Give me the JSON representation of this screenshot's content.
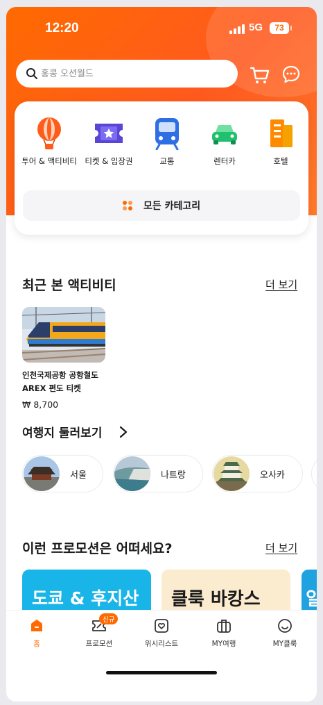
{
  "status_bar": {
    "time": "12:20",
    "network": "5G",
    "battery": "73"
  },
  "search": {
    "placeholder": "홍콩 오션월드"
  },
  "categories": [
    {
      "label": "투어 & 액티비티",
      "icon": "balloon-icon"
    },
    {
      "label": "티켓 & 입장권",
      "icon": "ticket-icon"
    },
    {
      "label": "교통",
      "icon": "train-icon"
    },
    {
      "label": "렌터카",
      "icon": "car-icon"
    },
    {
      "label": "호텔",
      "icon": "hotel-icon"
    }
  ],
  "all_categories_label": "모든 카테고리",
  "recent": {
    "title": "최근 본 액티비티",
    "more_label": "더 보기",
    "items": [
      {
        "title": "인천국제공항 공항철도 AREX 편도 티켓",
        "price": "₩ 8,700"
      }
    ]
  },
  "destinations": {
    "title": "여행지 둘러보기",
    "items": [
      {
        "label": "서울"
      },
      {
        "label": "나트랑"
      },
      {
        "label": "오사카"
      }
    ]
  },
  "promotions": {
    "title": "이런 프로모션은 어떠세요?",
    "more_label": "더 보기",
    "items": [
      {
        "text": "도쿄 & 후지산"
      },
      {
        "text": "클룩 바캉스"
      },
      {
        "text": "일"
      }
    ]
  },
  "tabbar": {
    "items": [
      {
        "label": "홈",
        "icon": "home-icon",
        "active": true
      },
      {
        "label": "프로모션",
        "icon": "coupon-icon",
        "badge": "신규"
      },
      {
        "label": "위시리스트",
        "icon": "wishlist-icon"
      },
      {
        "label": "MY여행",
        "icon": "suitcase-icon"
      },
      {
        "label": "MY클룩",
        "icon": "profile-icon"
      }
    ]
  },
  "colors": {
    "brand": "#ff6a00",
    "promo_blue": "#19b4e8",
    "promo_cream": "#fbecd0"
  }
}
